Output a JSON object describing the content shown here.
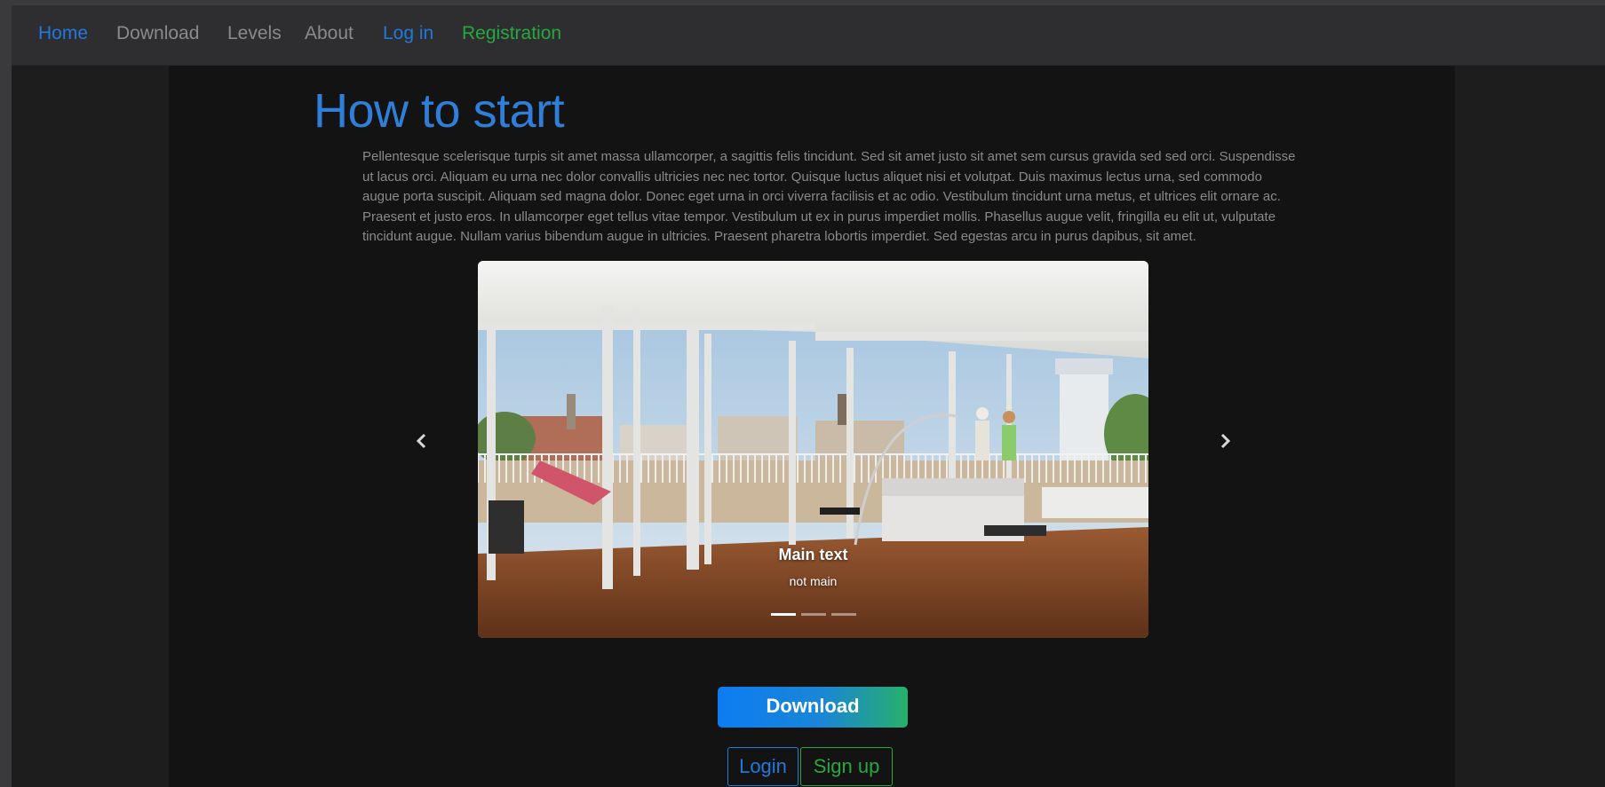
{
  "nav": {
    "home": "Home",
    "download": "Download",
    "levels": "Levels",
    "about": "About",
    "login": "Log in",
    "registration": "Registration"
  },
  "main": {
    "title": "How to start",
    "intro": "Pellentesque scelerisque turpis sit amet massa ullamcorper, a sagittis felis tincidunt. Sed sit amet justo sit amet sem cursus gravida sed sed orci. Suspendisse ut lacus orci. Aliquam eu urna nec dolor convallis ultricies nec nec tortor. Quisque luctus aliquet nisi et volutpat. Duis maximus lectus urna, sed commodo augue porta suscipit. Aliquam sed magna dolor. Donec eget urna in orci viverra facilisis et ac odio. Vestibulum tincidunt urna metus, et ultrices elit ornare ac. Praesent et justo eros. In ullamcorper eget tellus vitae tempor. Vestibulum ut ex in purus imperdiet mollis. Phasellus augue velit, fringilla eu elit ut, vulputate tincidunt augue. Nullam varius bibendum augue in ultricies. Praesent pharetra lobortis imperdiet. Sed egestas arcu in purus dapibus, sit amet."
  },
  "carousel": {
    "caption_title": "Main text",
    "caption_sub": "not main",
    "slide_count": 3,
    "active_slide": 1,
    "prev_icon": "chevron-left-icon",
    "next_icon": "chevron-right-icon"
  },
  "buttons": {
    "download": "Download",
    "login": "Login",
    "signup": "Sign up"
  },
  "colors": {
    "primary": "#1f7adf",
    "success": "#27a83f",
    "background": "#131313"
  }
}
